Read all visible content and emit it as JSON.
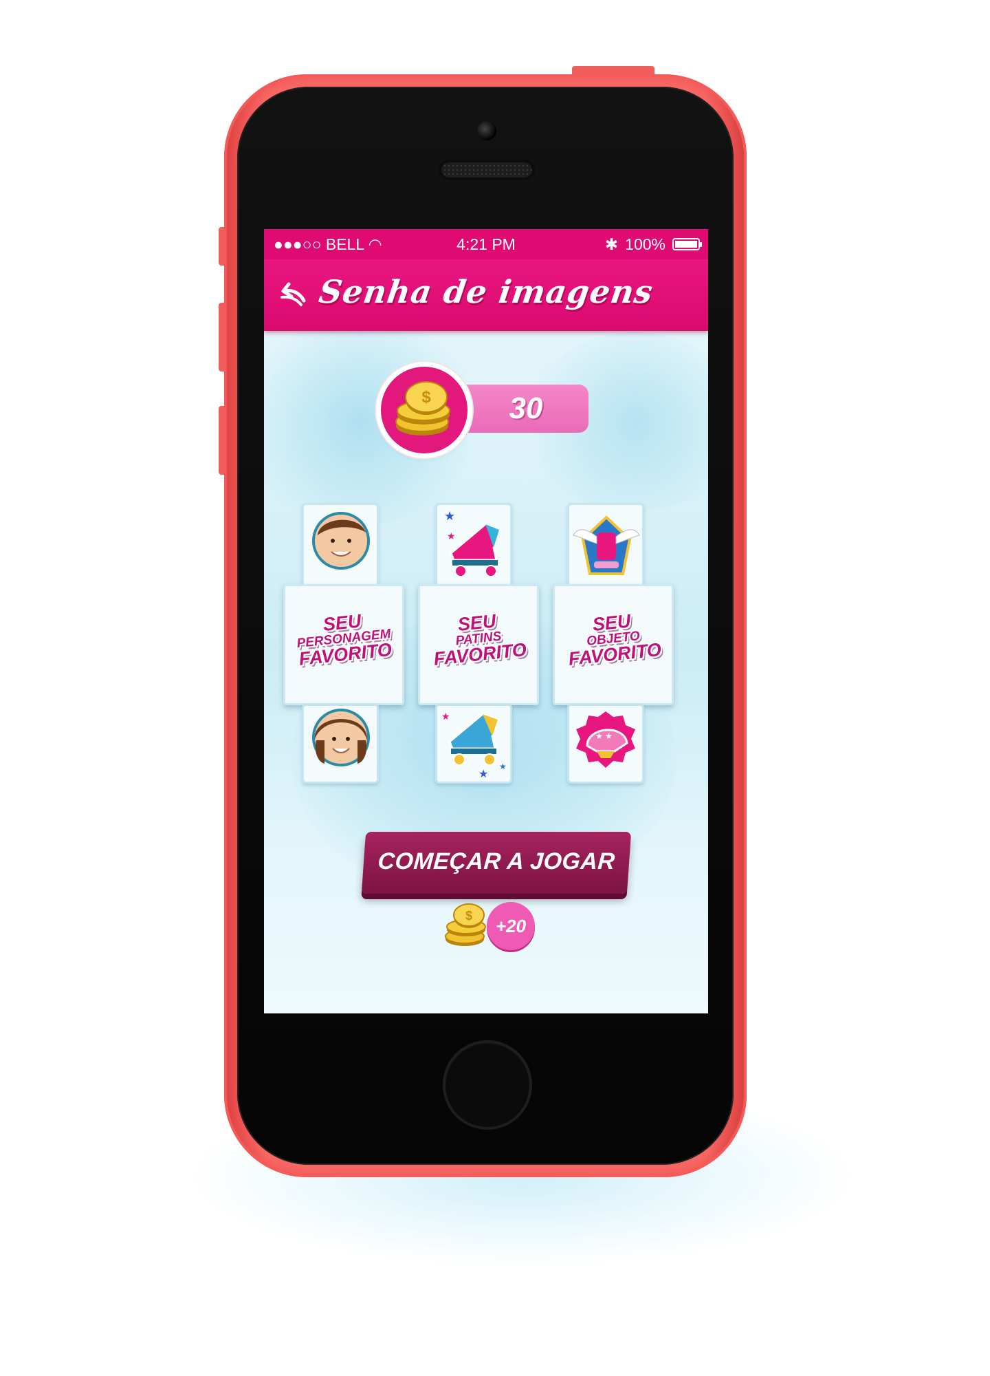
{
  "status_bar": {
    "carrier": "●●●○○ BELL",
    "time": "4:21 PM",
    "battery": "100%",
    "battery_fraction": 1.0
  },
  "nav": {
    "title": "Senha de imagens",
    "back_icon": "back-arrow-icon"
  },
  "coins": {
    "count": "30",
    "icon": "coin-stack-icon"
  },
  "cards": {
    "top_row": [
      "boy-avatar",
      "pink-roller-skate",
      "winged-skate-trophy"
    ],
    "labels": [
      {
        "line1": "SEU",
        "line2": "PERSONAGEM",
        "line3": "FAVORITO"
      },
      {
        "line1": "SEU",
        "line2": "PATINS",
        "line3": "FAVORITO"
      },
      {
        "line1": "SEU",
        "line2": "OBJETO",
        "line3": "FAVORITO"
      }
    ],
    "bottom_row": [
      "girl-avatar",
      "blue-roller-skate",
      "pink-helmet"
    ]
  },
  "actions": {
    "start_label": "COMEÇAR A JOGAR",
    "reward": "+20"
  },
  "colors": {
    "brand_pink": "#df0b72",
    "button_wine": "#8e1a4f",
    "counter_pink": "#ea6bb8",
    "phone_body": "#ff6b68"
  }
}
